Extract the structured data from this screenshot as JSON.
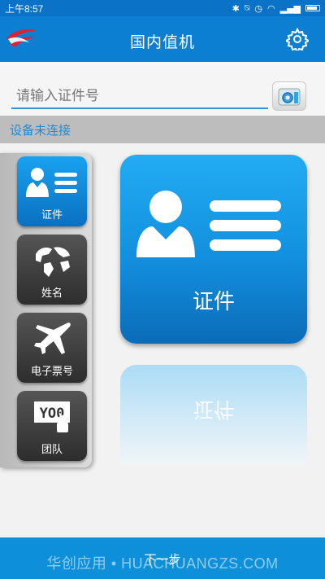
{
  "status_bar": {
    "time": "上午8:57",
    "icons": [
      "bluetooth-icon",
      "alarm-off-icon",
      "alarm-icon",
      "wifi-icon",
      "signal-icon",
      "battery-icon"
    ]
  },
  "app_bar": {
    "title": "国内值机",
    "logo_icon": "airline-logo-icon",
    "settings_icon": "gear-icon"
  },
  "search": {
    "placeholder": "请输入证件号",
    "value": "",
    "scan_icon": "camera-scan-icon"
  },
  "connection": {
    "status": "设备未连接",
    "color": "#1c8ad7"
  },
  "menu": {
    "items": [
      {
        "label": "证件",
        "icon": "id-card-icon",
        "active": true
      },
      {
        "label": "姓名",
        "icon": "globe-icon",
        "active": false
      },
      {
        "label": "电子票号",
        "icon": "airplane-icon",
        "active": false
      },
      {
        "label": "团队",
        "icon": "team-lock-icon",
        "active": false
      }
    ]
  },
  "main_card": {
    "label": "证件",
    "icon": "id-card-icon"
  },
  "footer": {
    "next_label": "下一步",
    "watermark": "华创应用 • HUACHUANGZS.COM"
  },
  "colors": {
    "accent": "#0d7fd3",
    "active_tile": "#128fde",
    "inactive_tile": "#3a3a3a"
  }
}
